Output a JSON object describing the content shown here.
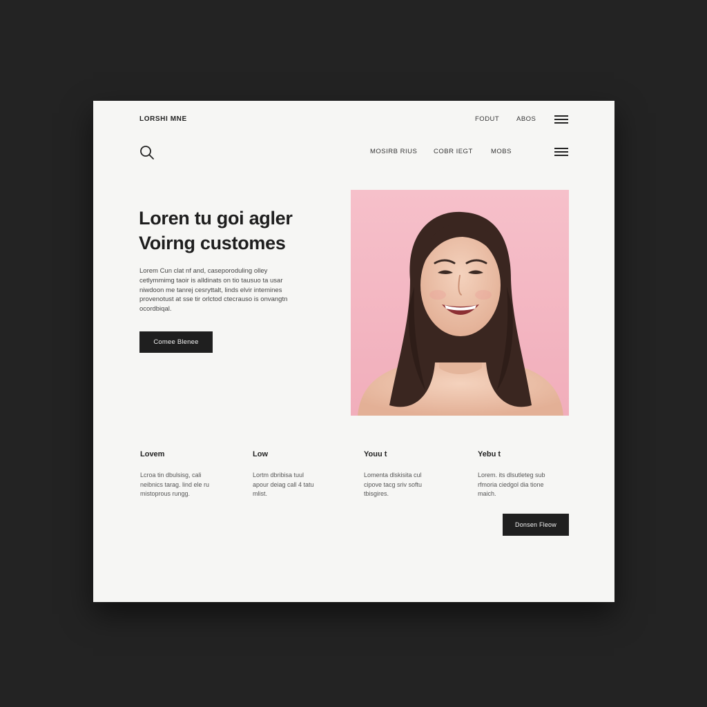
{
  "header": {
    "brand": "LORSHI MNE",
    "nav": [
      "FODUT",
      "ABOS"
    ]
  },
  "subheader": {
    "nav": [
      "MOSIRB RIUS",
      "COBR IEGT",
      "MOBS"
    ]
  },
  "hero": {
    "title_line1": "Loren tu goi agler",
    "title_line2": "Voirng customes",
    "body_lines": [
      "Lorem Cun clat nf and, caseporoduling olley",
      "cetlymmimg taoir is alldinats on tio tausuo ta usar",
      "niwdoon me tanrej cesryttalt, linds elvir intemines",
      "provenotust at sse tir orlctod ctecrauso is onvangtn",
      "ocordbiqal."
    ],
    "cta_label": "Comee Blenee"
  },
  "features": [
    {
      "title": "Lovem",
      "lines": [
        "Lcroa tin dbulsisg, cali",
        "neibnics tarag. lind ele ru",
        "mistoprous rungg."
      ]
    },
    {
      "title": "Low",
      "lines": [
        "Lortm dbribisa tuul",
        "apour deiag call 4 tatu",
        "mlist."
      ]
    },
    {
      "title": "Youu t",
      "lines": [
        "Lomenta dlskisita cul",
        "cipove tacg sriv softu",
        "tbisgires."
      ]
    },
    {
      "title": "Yebu t",
      "lines": [
        "Lorem. its dlsutleteg sub",
        "rfmoria ciedgol dia tione",
        "maich."
      ]
    }
  ],
  "footer": {
    "cta_label": "Donsen Fleow"
  },
  "colors": {
    "page_bg": "#232323",
    "card_bg": "#f6f6f4",
    "button_bg": "#1f1f1f",
    "portrait_bg": "#f4b8c2"
  }
}
